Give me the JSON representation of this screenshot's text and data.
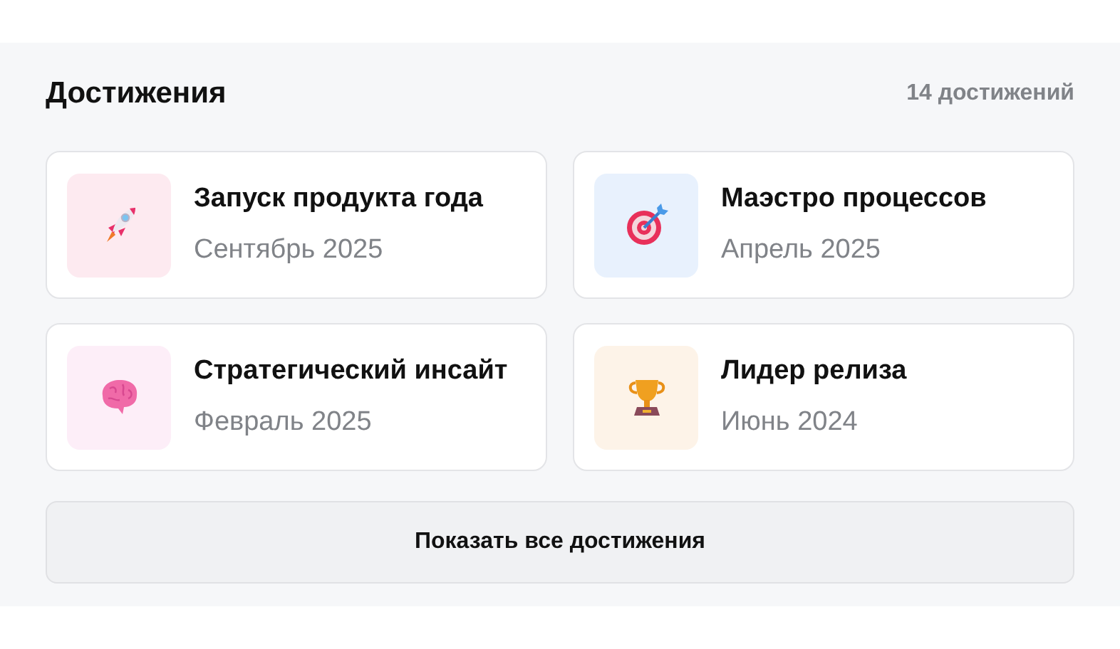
{
  "header": {
    "title": "Достижения",
    "count": "14 достижений"
  },
  "achievements": [
    {
      "kind": "rocket",
      "color": "#fdeaf0",
      "title": "Запуск продукта года",
      "date": "Сентябрь 2025"
    },
    {
      "kind": "target",
      "color": "#e8f1fd",
      "title": "Маэстро процессов",
      "date": "Апрель 2025"
    },
    {
      "kind": "brain",
      "color": "#fdeef8",
      "title": "Стратегический инсайт",
      "date": "Февраль 2025"
    },
    {
      "kind": "trophy",
      "color": "#fdf3e8",
      "title": "Лидер релиза",
      "date": "Июнь 2024"
    }
  ],
  "button": "Показать все достижения"
}
